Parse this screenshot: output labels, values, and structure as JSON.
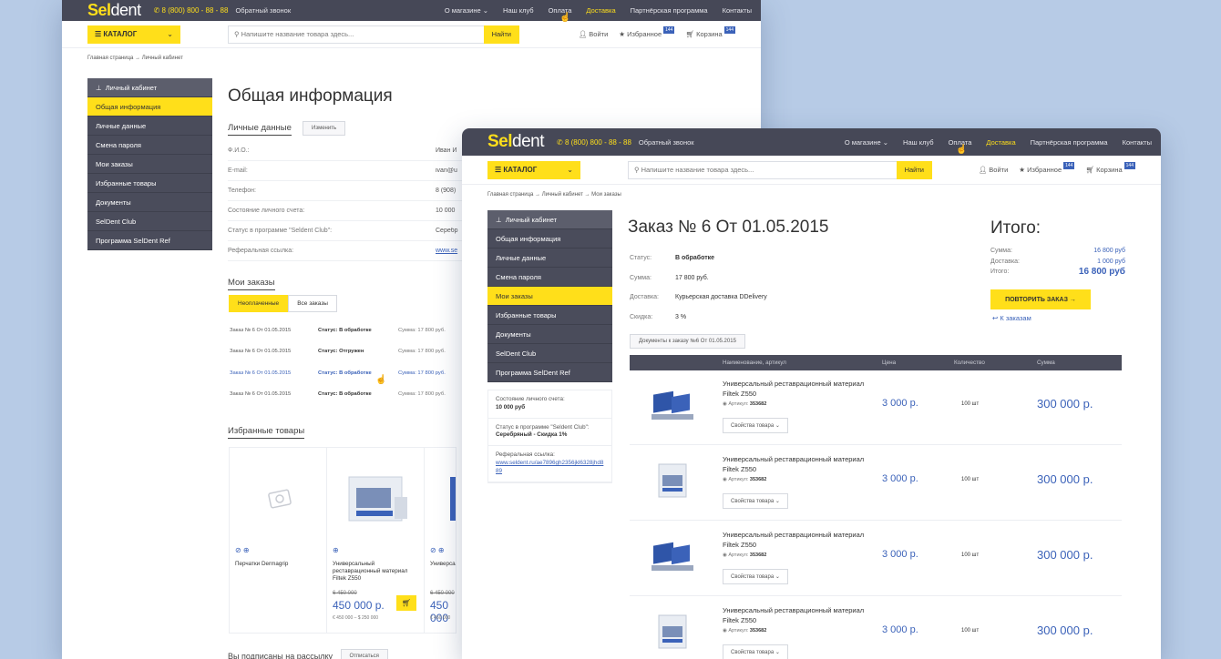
{
  "brand": {
    "logo_a": "Sel",
    "logo_b": "dent",
    "phone": "8 (800) 800 - 88 - 88",
    "callback": "Обратный звонок"
  },
  "nav": [
    "О магазине ⌄",
    "Наш клуб",
    "Оплата",
    "Доставка",
    "Партнёрская программа",
    "Контакты"
  ],
  "header": {
    "catalog": "КАТАЛОГ",
    "search_placeholder": "Напишите название товара здесь...",
    "search_button": "Найти",
    "login": "Войти",
    "favorites": "Избранное",
    "favorites_count": "144",
    "cart": "Корзина",
    "cart_count": "144"
  },
  "colors": {
    "accent": "#ffdf1a",
    "dark": "#464857",
    "link": "#3b62b9"
  },
  "page1": {
    "breadcrumb": "Главная страница → Личный кабинет",
    "sidebar": [
      "Личный кабинет",
      "Общая информация",
      "Личные данные",
      "Смена пароля",
      "Мои заказы",
      "Избранные товары",
      "Документы",
      "SelDent Club",
      "Программа SelDent Ref"
    ],
    "title": "Общая информация",
    "personal_title": "Личные данные",
    "edit_button": "Изменить",
    "personal": [
      {
        "k": "Ф.И.О.:",
        "v": "Иван И"
      },
      {
        "k": "E-mail:",
        "v": "ivan@u"
      },
      {
        "k": "Телефон:",
        "v": "8 (908)"
      },
      {
        "k": "Состояние личного счета:",
        "v": "10 000"
      },
      {
        "k": "Статус в программе \"Seldent Club\":",
        "v": "Серебр"
      },
      {
        "k": "Реферальная ссылка:",
        "v": "www.se"
      }
    ],
    "orders_title": "Мои заказы",
    "tab_unpaid": "Неоплаченные",
    "tab_all": "Все заказы",
    "orders": [
      {
        "name": "Заказ № 6 От 01.05.2015",
        "status": "Статус: В обработке",
        "sum": "Сумма: 17 800 руб."
      },
      {
        "name": "Заказ № 6 От 01.05.2015",
        "status": "Статус: Отгружен",
        "sum": "Сумма: 17 800 руб."
      },
      {
        "name": "Заказ № 6 От 01.05.2015",
        "status": "Статус: В обработке",
        "sum": "Сумма: 17 800 руб."
      },
      {
        "name": "Заказ № 6 От 01.05.2015",
        "status": "Статус: В обработке",
        "sum": "Сумма: 17 800 руб."
      }
    ],
    "fav_title": "Избранные товары",
    "fav": [
      {
        "name": "Перчатки Dermagrip",
        "old": "",
        "price": "",
        "range": ""
      },
      {
        "name": "Универсальный реставрационный материал Filtek Z550",
        "old": "6 450 000",
        "price": "450 000 р.",
        "range": "€ 450 000 – $ 250 000"
      },
      {
        "name": "Универсальный реставрационный материал Filtek Z550",
        "old": "6 450 000",
        "price": "450 000 р.",
        "range": "€ 450 000 – $ 250 000"
      },
      {
        "name": "Универсальный реставрационный материал",
        "old": "6 450 000",
        "price": "450 000",
        "range": "€ 450 000"
      }
    ],
    "subscribe": "Вы подписаны на рассылку",
    "unsubscribe": "Отписаться"
  },
  "page2": {
    "breadcrumb": "Главная страница → Личный кабинет → Мои заказы",
    "sidebar": [
      "Личный кабинет",
      "Общая информация",
      "Личные данные",
      "Смена пароля",
      "Мои заказы",
      "Избранные товары",
      "Документы",
      "SelDent Club",
      "Программа SelDent Ref"
    ],
    "title": "Заказ № 6 От 01.05.2015",
    "details": [
      {
        "k": "Статус:",
        "v": "В обработке"
      },
      {
        "k": "Сумма:",
        "v": "17 800 руб."
      },
      {
        "k": "Доставка:",
        "v": "Курьерская доставка DDelivery"
      },
      {
        "k": "Скидка:",
        "v": "3 %"
      }
    ],
    "docs_button": "Документы к заказу №6 От 01.05.2015",
    "total_title": "Итого:",
    "totals": [
      {
        "k": "Сумма:",
        "v": "16 800 руб"
      },
      {
        "k": "Доставка:",
        "v": "1 000 руб"
      },
      {
        "k": "Итого:",
        "v": "16 800 руб"
      }
    ],
    "repeat_button": "ПОВТОРИТЬ ЗАКАЗ →",
    "back_link": "↩ К заказам",
    "table_head": [
      "Наименование, артикул",
      "Цена",
      "Количество",
      "Сумма"
    ],
    "products": [
      {
        "name": "Универсальный реставрационный материал Filtek Z550",
        "art_label": "Артикул:",
        "art": "353682",
        "props": "Свойства товара ⌄",
        "price": "3 000 р.",
        "qty": "100 шт",
        "sum": "300 000 р."
      },
      {
        "name": "Универсальный реставрационный материал Filtek Z550",
        "art_label": "Артикул:",
        "art": "353682",
        "props": "Свойства товара ⌄",
        "price": "3 000 р.",
        "qty": "100 шт",
        "sum": "300 000 р."
      },
      {
        "name": "Универсальный реставрационный материал Filtek Z550",
        "art_label": "Артикул:",
        "art": "353682",
        "props": "Свойства товара ⌄",
        "price": "3 000 р.",
        "qty": "100 шт",
        "sum": "300 000 р."
      },
      {
        "name": "Универсальный реставрационный материал Filtek Z550",
        "art_label": "Артикул:",
        "art": "353682",
        "props": "Свойства товара ⌄",
        "price": "3 000 р.",
        "qty": "100 шт",
        "sum": "300 000 р."
      }
    ],
    "info": {
      "balance_label": "Состояние личного счета:",
      "balance": "10 000 руб",
      "status_label": "Статус в программе \"Seldent Club\":",
      "status": "Серебряный - Скидка 1%",
      "ref_label": "Реферальная ссылка:",
      "ref": "www.seldent.ru/ae7896gh2356jkl6328jhd889"
    }
  }
}
